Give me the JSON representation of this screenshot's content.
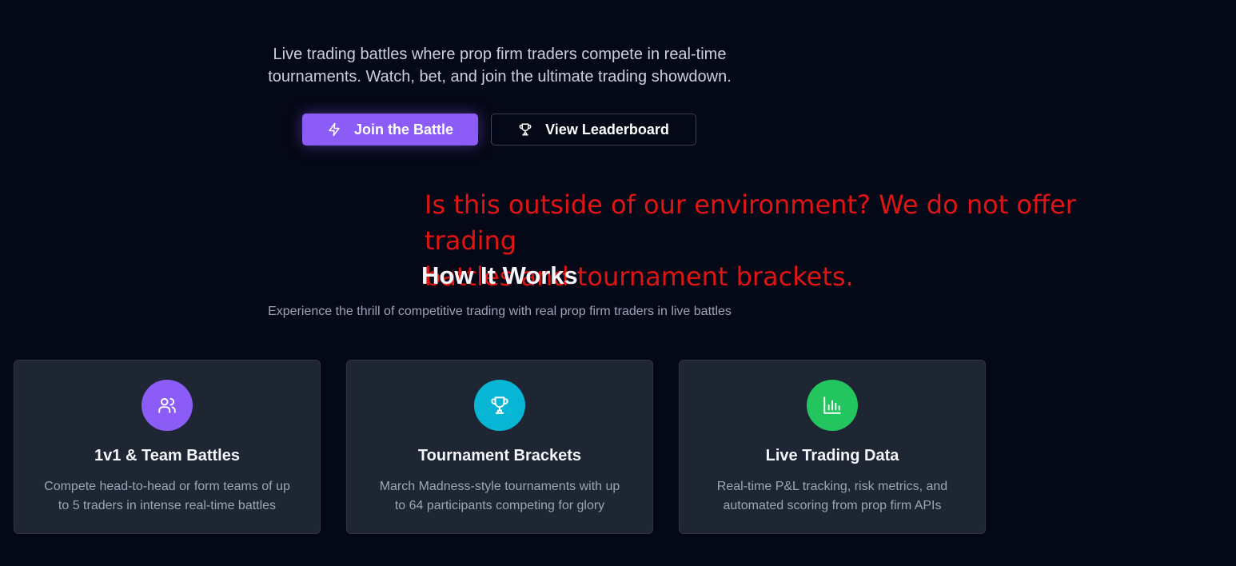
{
  "hero": {
    "subtitle_line1": "Live trading battles where prop firm traders compete in real-time",
    "subtitle_line2": "tournaments. Watch, bet, and join the ultimate trading showdown.",
    "primary_button": {
      "label": "Join the Battle",
      "icon": "lightning-icon",
      "color": "#8b5cf6"
    },
    "secondary_button": {
      "label": "View Leaderboard",
      "icon": "trophy-icon"
    }
  },
  "annotation": {
    "line1": "Is this outside of our environment?  We do not offer trading",
    "line2": "battles and tournament brackets.",
    "color": "#e11414"
  },
  "how_it_works": {
    "title": "How It Works",
    "description": "Experience the thrill of competitive trading with real prop firm traders in live battles",
    "cards": [
      {
        "title": "1v1 & Team Battles",
        "text_line1": "Compete head-to-head or form teams of up",
        "text_line2": "to 5 traders in intense real-time battles",
        "icon": "users-icon",
        "icon_color": "#8b5cf6"
      },
      {
        "title": "Tournament Brackets",
        "text_line1": "March Madness-style tournaments with up",
        "text_line2": "to 64 participants competing for glory",
        "icon": "trophy-icon",
        "icon_color": "#06b6d4"
      },
      {
        "title": "Live Trading Data",
        "text_line1": "Real-time P&L tracking, risk metrics, and",
        "text_line2": "automated scoring from prop firm APIs",
        "icon": "bar-chart-icon",
        "icon_color": "#22c55e"
      }
    ]
  },
  "colors": {
    "background": "#050816",
    "card_background": "#1e2533"
  }
}
